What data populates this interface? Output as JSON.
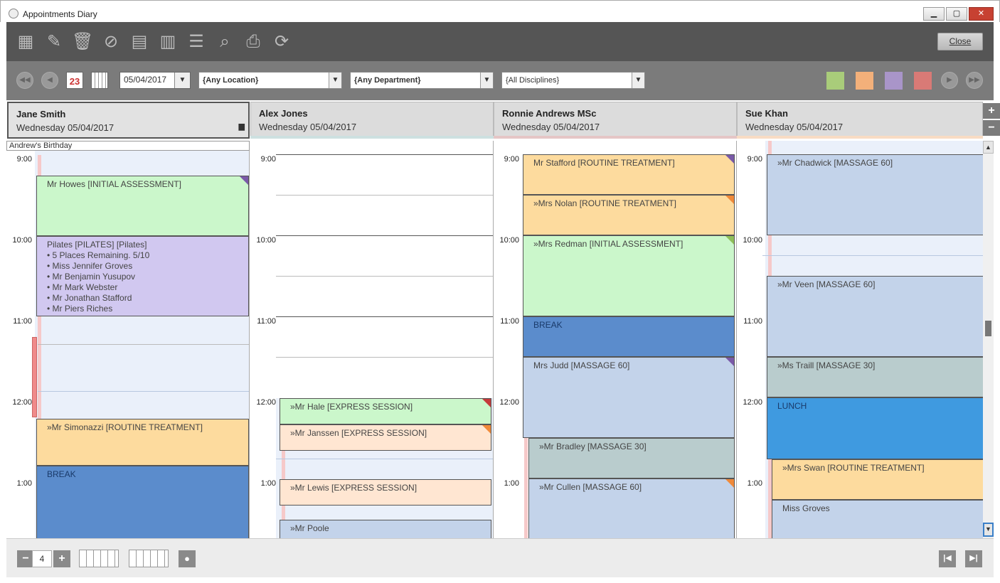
{
  "window": {
    "title": "Appointments Diary",
    "btn_min": "▁",
    "btn_max": "▢",
    "btn_close": "✕"
  },
  "toolbar": {
    "close_label": "Close"
  },
  "nav": {
    "date": "05/04/2017",
    "calendar_day": "23",
    "location": "{Any Location}",
    "department": "{Any Department}",
    "discipline": "{All Disciplines}"
  },
  "columns": [
    {
      "name": "Jane Smith",
      "date": "Wednesday 05/04/2017"
    },
    {
      "name": "Alex Jones",
      "date": "Wednesday 05/04/2017"
    },
    {
      "name": "Ronnie Andrews MSc",
      "date": "Wednesday 05/04/2017"
    },
    {
      "name": "Sue Khan",
      "date": "Wednesday 05/04/2017"
    }
  ],
  "hours": [
    "9:00",
    "10:00",
    "11:00",
    "12:00",
    "1:00"
  ],
  "allday_event": "Andrew's Birthday",
  "appointments": {
    "c0": [
      {
        "text": "Mr Howes [INITIAL ASSESSMENT]"
      },
      {
        "lines": [
          "Pilates [PILATES] [Pilates]",
          "• 5 Places Remaining. 5/10",
          "• Miss Jennifer Groves",
          "• Mr Benjamin Yusupov",
          "• Mr Mark Webster",
          "• Mr Jonathan Stafford",
          "• Mr Piers Riches"
        ]
      },
      {
        "text": "»Mr Simonazzi [ROUTINE TREATMENT]"
      },
      {
        "text": "BREAK"
      }
    ],
    "c1": [
      {
        "text": "»Mr Hale [EXPRESS SESSION]"
      },
      {
        "text": "»Mr Janssen [EXPRESS SESSION]"
      },
      {
        "text": "»Mr Lewis [EXPRESS SESSION]"
      },
      {
        "text": "»Mr Poole"
      }
    ],
    "c2": [
      {
        "text": "Mr Stafford [ROUTINE TREATMENT]"
      },
      {
        "text": "»Mrs Nolan [ROUTINE TREATMENT]"
      },
      {
        "text": "»Mrs Redman [INITIAL ASSESSMENT]"
      },
      {
        "text": "BREAK"
      },
      {
        "text": "Mrs Judd [MASSAGE 60]"
      },
      {
        "text": "»Mr Bradley [MASSAGE 30]"
      },
      {
        "text": "»Mr Cullen [MASSAGE 60]"
      }
    ],
    "c3": [
      {
        "text": "»Mr Chadwick [MASSAGE 60]"
      },
      {
        "text": "»Mr Veen [MASSAGE 60]"
      },
      {
        "text": "»Ms Traill [MASSAGE 30]"
      },
      {
        "text": "LUNCH"
      },
      {
        "text": "»Mrs Swan [ROUTINE TREATMENT]"
      },
      {
        "text": "Miss Groves"
      }
    ]
  },
  "bottom": {
    "column_count": "4"
  },
  "colors": {
    "green": "#a9cc7a",
    "orange": "#f3b07a",
    "purple": "#a995c9",
    "red": "#d97a76"
  }
}
